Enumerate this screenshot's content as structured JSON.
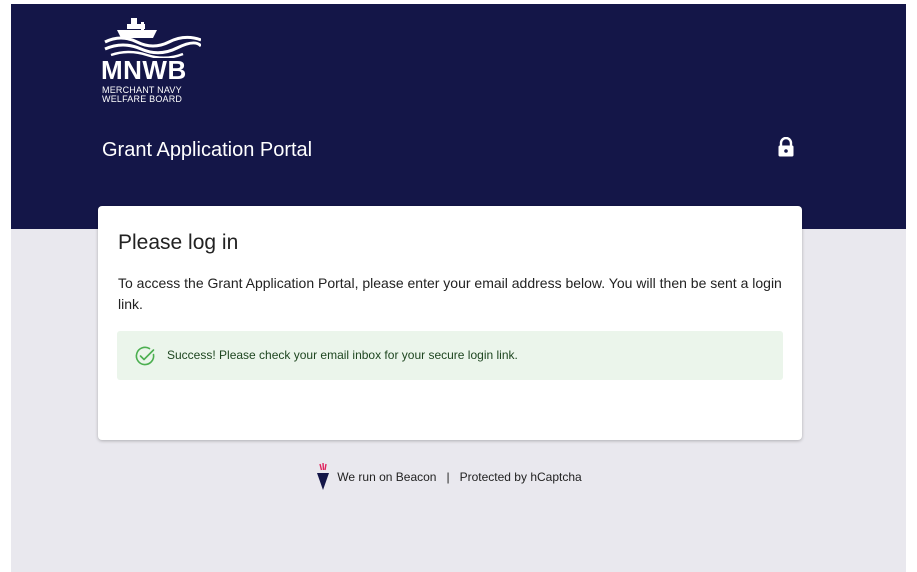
{
  "header": {
    "logo": {
      "mark": "MNWB",
      "line1": "MERCHANT NAVY",
      "line2": "WELFARE BOARD"
    },
    "portal_title": "Grant Application Portal",
    "lock_icon": "lock-icon"
  },
  "card": {
    "title": "Please log in",
    "text": "To access the Grant Application Portal, please enter your email address below. You will then be sent a login link.",
    "alert": {
      "icon": "check-circle-icon",
      "text": "Success! Please check your email inbox for your secure login link."
    }
  },
  "footer": {
    "beacon_text": "We run on Beacon",
    "separator": "|",
    "captcha_text": "Protected by hCaptcha"
  },
  "colors": {
    "header_bg": "#141648",
    "page_bg": "#e9e8ee",
    "alert_bg": "#ebf5eb",
    "alert_text": "#1e4620",
    "success_icon": "#4caf50",
    "beacon_accent": "#e0245e"
  }
}
